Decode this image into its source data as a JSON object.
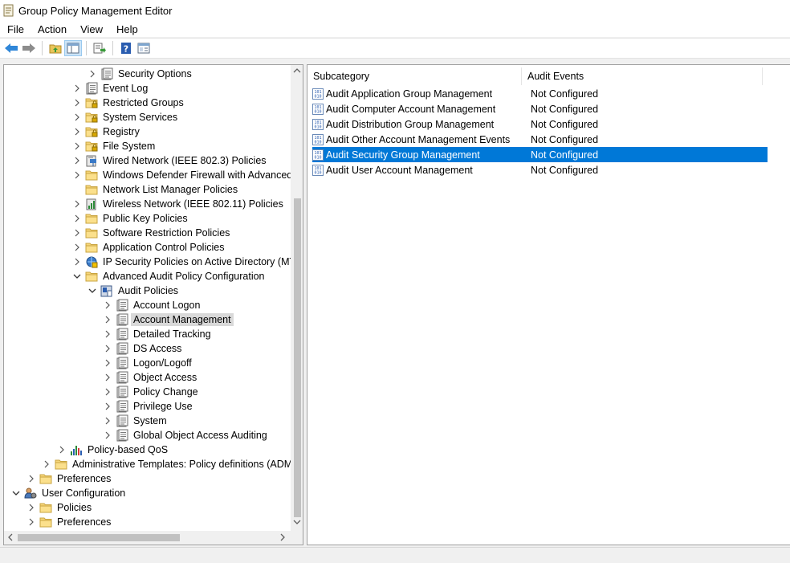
{
  "window": {
    "title": "Group Policy Management Editor"
  },
  "menu": [
    "File",
    "Action",
    "View",
    "Help"
  ],
  "toolbar": {
    "buttons": [
      "back-icon",
      "forward-icon",
      "up-folder-icon",
      "show-hide-tree-icon",
      "export-list-icon",
      "help-icon",
      "properties-icon"
    ]
  },
  "tree": [
    {
      "label": "Security Options",
      "icon": "policy-book-icon",
      "expander": "collapsed",
      "depth": 6
    },
    {
      "label": "Event Log",
      "icon": "policy-book-icon",
      "expander": "collapsed",
      "depth": 5
    },
    {
      "label": "Restricted Groups",
      "icon": "lock-folder-icon",
      "expander": "collapsed",
      "depth": 5
    },
    {
      "label": "System Services",
      "icon": "lock-folder-icon",
      "expander": "collapsed",
      "depth": 5
    },
    {
      "label": "Registry",
      "icon": "lock-folder-icon",
      "expander": "collapsed",
      "depth": 5
    },
    {
      "label": "File System",
      "icon": "lock-folder-icon",
      "expander": "collapsed",
      "depth": 5
    },
    {
      "label": "Wired Network (IEEE 802.3) Policies",
      "icon": "network-icon",
      "expander": "collapsed",
      "depth": 5
    },
    {
      "label": "Windows Defender Firewall with Advanced Security",
      "icon": "folder-icon",
      "expander": "collapsed",
      "depth": 5
    },
    {
      "label": "Network List Manager Policies",
      "icon": "folder-icon",
      "expander": "none",
      "depth": 5
    },
    {
      "label": "Wireless Network (IEEE 802.11) Policies",
      "icon": "wireless-icon",
      "expander": "collapsed",
      "depth": 5
    },
    {
      "label": "Public Key Policies",
      "icon": "folder-icon",
      "expander": "collapsed",
      "depth": 5
    },
    {
      "label": "Software Restriction Policies",
      "icon": "folder-icon",
      "expander": "collapsed",
      "depth": 5
    },
    {
      "label": "Application Control Policies",
      "icon": "folder-icon",
      "expander": "collapsed",
      "depth": 5
    },
    {
      "label": "IP Security Policies on Active Directory (MTLAB.LOCAL)",
      "icon": "ip-security-icon",
      "expander": "collapsed",
      "depth": 5
    },
    {
      "label": "Advanced Audit Policy Configuration",
      "icon": "folder-icon",
      "expander": "expanded",
      "depth": 5
    },
    {
      "label": "Audit Policies",
      "icon": "audit-policies-icon",
      "expander": "expanded",
      "depth": 6
    },
    {
      "label": "Account Logon",
      "icon": "policy-book-icon",
      "expander": "collapsed",
      "depth": 7
    },
    {
      "label": "Account Management",
      "icon": "policy-book-icon",
      "expander": "collapsed",
      "depth": 7,
      "selected": true
    },
    {
      "label": "Detailed Tracking",
      "icon": "policy-book-icon",
      "expander": "collapsed",
      "depth": 7
    },
    {
      "label": "DS Access",
      "icon": "policy-book-icon",
      "expander": "collapsed",
      "depth": 7
    },
    {
      "label": "Logon/Logoff",
      "icon": "policy-book-icon",
      "expander": "collapsed",
      "depth": 7
    },
    {
      "label": "Object Access",
      "icon": "policy-book-icon",
      "expander": "collapsed",
      "depth": 7
    },
    {
      "label": "Policy Change",
      "icon": "policy-book-icon",
      "expander": "collapsed",
      "depth": 7
    },
    {
      "label": "Privilege Use",
      "icon": "policy-book-icon",
      "expander": "collapsed",
      "depth": 7
    },
    {
      "label": "System",
      "icon": "policy-book-icon",
      "expander": "collapsed",
      "depth": 7
    },
    {
      "label": "Global Object Access Auditing",
      "icon": "policy-book-icon",
      "expander": "collapsed",
      "depth": 7
    },
    {
      "label": "Policy-based QoS",
      "icon": "qos-chart-icon",
      "expander": "collapsed",
      "depth": 4
    },
    {
      "label": "Administrative Templates: Policy definitions (ADMX files)",
      "icon": "folder-icon",
      "expander": "collapsed",
      "depth": 3
    },
    {
      "label": "Preferences",
      "icon": "folder-icon",
      "expander": "collapsed",
      "depth": 2
    },
    {
      "label": "User Configuration",
      "icon": "user-config-icon",
      "expander": "expanded",
      "depth": 1
    },
    {
      "label": "Policies",
      "icon": "folder-icon",
      "expander": "collapsed",
      "depth": 2
    },
    {
      "label": "Preferences",
      "icon": "folder-icon",
      "expander": "collapsed",
      "depth": 2
    }
  ],
  "list": {
    "columns": [
      "Subcategory",
      "Audit Events"
    ],
    "rows": [
      {
        "subcategory": "Audit Application Group Management",
        "audit_events": "Not Configured"
      },
      {
        "subcategory": "Audit Computer Account Management",
        "audit_events": "Not Configured"
      },
      {
        "subcategory": "Audit Distribution Group Management",
        "audit_events": "Not Configured"
      },
      {
        "subcategory": "Audit Other Account Management Events",
        "audit_events": "Not Configured"
      },
      {
        "subcategory": "Audit Security Group Management",
        "audit_events": "Not Configured",
        "selected": true
      },
      {
        "subcategory": "Audit User Account Management",
        "audit_events": "Not Configured"
      }
    ]
  },
  "colors": {
    "selection": "#0078d7",
    "tree_selection": "#d9d9d9",
    "folder": "#f6d67a"
  }
}
